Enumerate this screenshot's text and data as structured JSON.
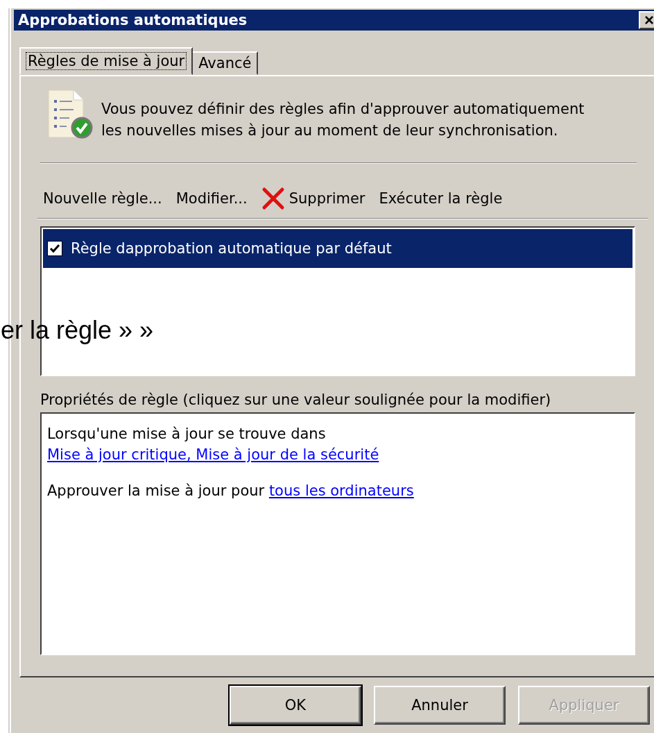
{
  "slide_text": "er la règle » »",
  "window": {
    "title": "Approbations automatiques",
    "close": "×"
  },
  "tabs": [
    {
      "label": "Règles de mise à jour",
      "selected": true
    },
    {
      "label": "Avancé",
      "selected": false
    }
  ],
  "description": "Vous pouvez définir des règles afin d'approuver automatiquement les nouvelles mises à jour au moment de leur synchronisation.",
  "toolbar": [
    {
      "label": "Nouvelle règle...",
      "kind": "text"
    },
    {
      "label": "Modifier...",
      "kind": "text"
    },
    {
      "label": "Supprimer",
      "kind": "delete"
    },
    {
      "label": "Exécuter la règle",
      "kind": "text"
    }
  ],
  "rules": [
    {
      "name": "Règle dapprobation automatique par défaut",
      "checked": true,
      "selected": true
    }
  ],
  "properties": {
    "label": "Propriétés de règle (cliquez sur une valeur soulignée pour la modifier)",
    "paragraphs": [
      [
        {
          "text": "Lorsqu'une mise à jour se trouve dans ",
          "kind": "plain"
        },
        {
          "text": "Mise à jour critique, Mise à jour de la sécurité",
          "kind": "link"
        }
      ],
      [
        {
          "text": "Approuver la mise à jour pour ",
          "kind": "plain"
        },
        {
          "text": "tous les ordinateurs",
          "kind": "link"
        }
      ]
    ]
  },
  "buttons": [
    {
      "label": "OK",
      "default": true,
      "disabled": false
    },
    {
      "label": "Annuler",
      "default": false,
      "disabled": false
    },
    {
      "label": "Appliquer",
      "default": false,
      "disabled": true
    }
  ]
}
